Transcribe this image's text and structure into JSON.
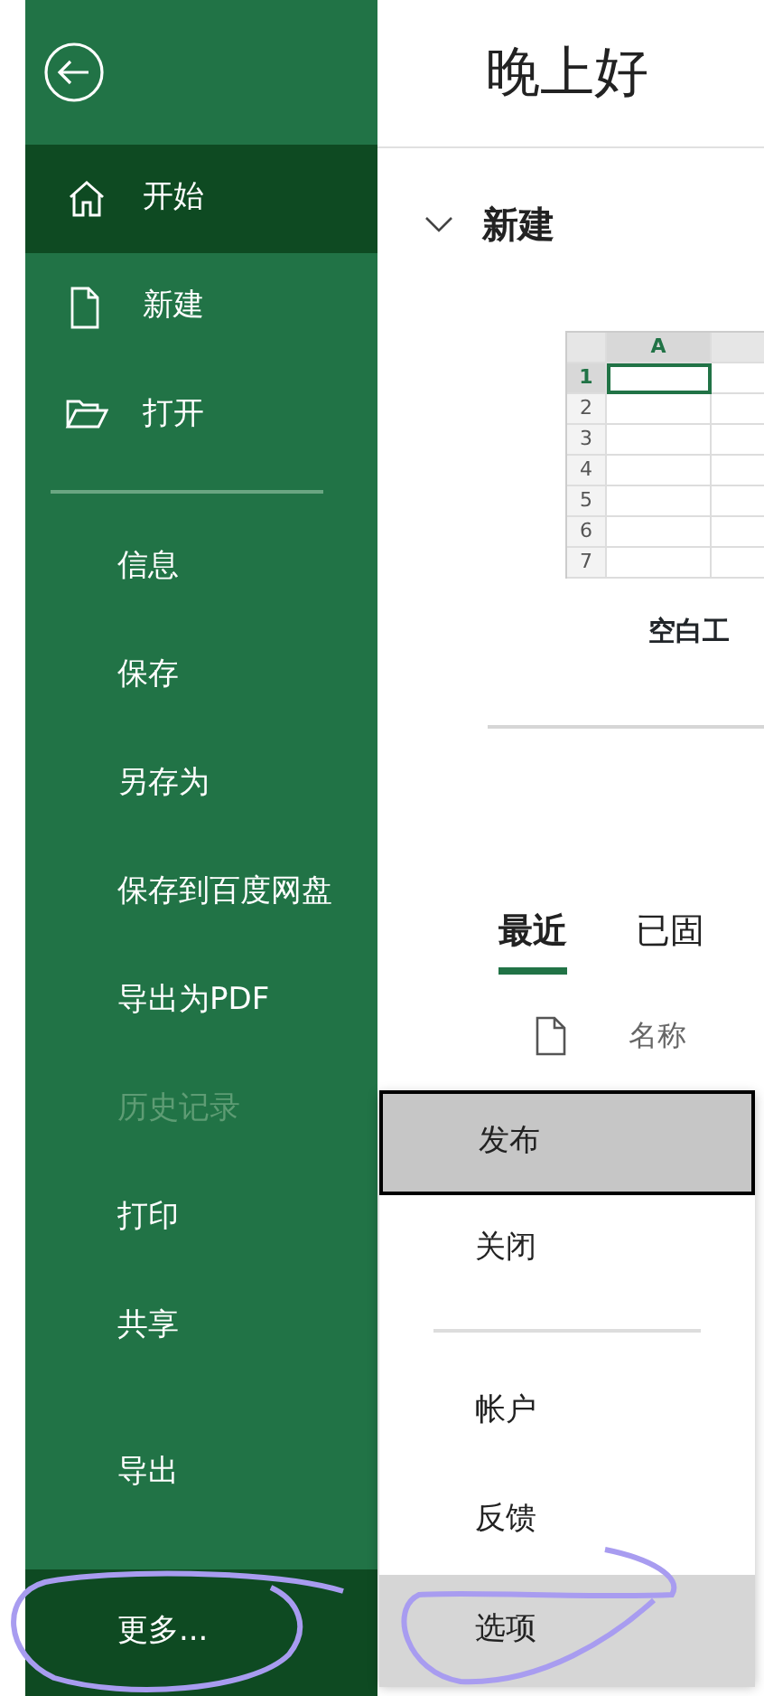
{
  "sidebar": {
    "top_items": [
      {
        "label": "开始",
        "selected": true
      },
      {
        "label": "新建",
        "selected": false
      },
      {
        "label": "打开",
        "selected": false
      }
    ],
    "middle_items": [
      {
        "label": "信息",
        "disabled": false
      },
      {
        "label": "保存",
        "disabled": false
      },
      {
        "label": "另存为",
        "disabled": false
      },
      {
        "label": "保存到百度网盘",
        "disabled": false
      },
      {
        "label": "导出为PDF",
        "disabled": false
      },
      {
        "label": "历史记录",
        "disabled": true
      },
      {
        "label": "打印",
        "disabled": false
      },
      {
        "label": "共享",
        "disabled": false
      }
    ],
    "bottom_items": [
      {
        "label": "导出",
        "selected": false
      },
      {
        "label": "更多...",
        "selected": true
      }
    ]
  },
  "main": {
    "greeting": "晚上好",
    "new_section": {
      "title": "新建",
      "expanded": true,
      "template": {
        "name": "空白工",
        "columns": [
          "A"
        ],
        "rows": [
          "1",
          "2",
          "3",
          "4",
          "5",
          "6",
          "7"
        ]
      }
    },
    "tabs": [
      {
        "label": "最近",
        "selected": true
      },
      {
        "label": "已固",
        "selected": false
      }
    ],
    "file_list": {
      "columns": [
        "名称"
      ]
    }
  },
  "more_menu": [
    {
      "kind": "item",
      "label": "发布",
      "selected": true,
      "highlighted": false
    },
    {
      "kind": "item",
      "label": "关闭",
      "selected": false,
      "highlighted": false
    },
    {
      "kind": "divider"
    },
    {
      "kind": "item",
      "label": "帐户",
      "selected": false,
      "highlighted": false
    },
    {
      "kind": "item",
      "label": "反馈",
      "selected": false,
      "highlighted": false
    },
    {
      "kind": "item",
      "label": "选项",
      "selected": false,
      "highlighted": true
    }
  ]
}
